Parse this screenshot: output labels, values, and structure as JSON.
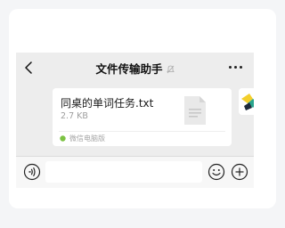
{
  "header": {
    "title": "文件传输助手",
    "back_icon": "chevron-left-icon",
    "mute_icon": "muted-bell-icon",
    "more_icon": "more-dots-icon"
  },
  "message": {
    "file_name": "同桌的单词任务.txt",
    "file_size": "2.7 KB",
    "file_icon": "document-icon",
    "source_label": "微信电脑版",
    "source_color": "#7cc243"
  },
  "input_bar": {
    "voice_icon": "voice-icon",
    "emoji_icon": "emoji-icon",
    "plus_icon": "plus-icon",
    "text_value": ""
  },
  "colors": {
    "chat_background": "#ededed",
    "card_background": "#ffffff",
    "avatar_accent": "#f3cf2c",
    "avatar_secondary": "#2aa58e"
  }
}
